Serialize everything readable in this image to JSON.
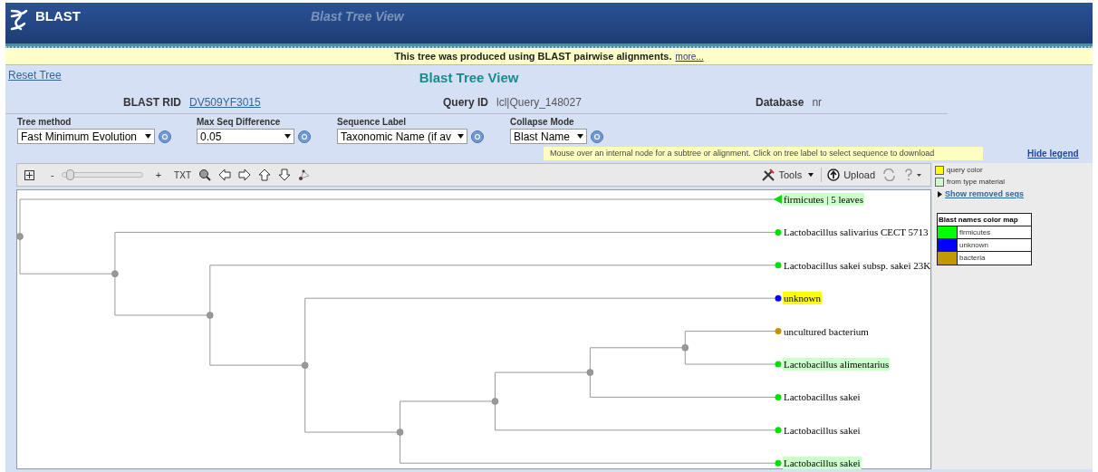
{
  "header": {
    "logo_text": "BLAST",
    "title": "Blast Tree View"
  },
  "notice": {
    "text": "This tree was produced using BLAST pairwise alignments.",
    "link": "more..."
  },
  "reset_link": "Reset Tree",
  "page_title": "Blast Tree View",
  "info": [
    {
      "label": "BLAST RID",
      "value": "DV509YF3015",
      "kind": "link"
    },
    {
      "label": "Query ID",
      "value": "lcl|Query_148027",
      "kind": "plain"
    },
    {
      "label": "Database",
      "value": "nr",
      "kind": "plain"
    }
  ],
  "controls": [
    {
      "label": "Tree method",
      "value": "Fast Minimum Evolution"
    },
    {
      "label": "Max Seq Difference",
      "value": "0.05"
    },
    {
      "label": "Sequence Label",
      "value": "Taxonomic Name (if av"
    },
    {
      "label": "Collapse Mode",
      "value": "Blast Name"
    }
  ],
  "hint": "Mouse over an internal node for a subtree or alignment. Click on tree label to select sequence to download",
  "hide_legend": "Hide legend",
  "toolbar": {
    "zoom_out": "-",
    "zoom_in": "+",
    "txt": "TXT",
    "level": 0.05,
    "tools": "Tools",
    "upload": "Upload"
  },
  "tree": {
    "children": [
      {
        "label": "firmicutes | 5 leaves",
        "kind": "collapsed",
        "color": "#00e000",
        "query": false,
        "type_material": true
      },
      {
        "children": [
          {
            "label": "Lactobacillus salivarius CECT 5713",
            "kind": "leaf",
            "color": "#00e000",
            "query": false,
            "type_material": false
          },
          {
            "children": [
              {
                "label": "Lactobacillus sakei subsp. sakei 23K",
                "kind": "leaf",
                "color": "#00e000",
                "query": false,
                "type_material": false
              },
              {
                "children": [
                  {
                    "label": "unknown",
                    "kind": "leaf",
                    "color": "#0000ff",
                    "query": true,
                    "type_material": false
                  },
                  {
                    "children": [
                      {
                        "children": [
                          {
                            "children": [
                              {
                                "children": [
                                  {
                                    "label": "uncultured bacterium",
                                    "kind": "leaf",
                                    "color": "#c09400",
                                    "query": false,
                                    "type_material": false
                                  },
                                  {
                                    "label": "Lactobacillus alimentarius",
                                    "kind": "leaf",
                                    "color": "#00e000",
                                    "query": false,
                                    "type_material": true
                                  }
                                ]
                              },
                              {
                                "label": "Lactobacillus sakei",
                                "kind": "leaf",
                                "color": "#00e000",
                                "query": false,
                                "type_material": false
                              }
                            ]
                          },
                          {
                            "label": "Lactobacillus sakei",
                            "kind": "leaf",
                            "color": "#00e000",
                            "query": false,
                            "type_material": false
                          }
                        ]
                      },
                      {
                        "label": "Lactobacillus sakei",
                        "kind": "leaf",
                        "color": "#00e000",
                        "query": false,
                        "type_material": true
                      }
                    ]
                  }
                ]
              }
            ]
          }
        ]
      }
    ]
  },
  "legend": {
    "keys": [
      {
        "label": "query color",
        "color": "#ffff00"
      },
      {
        "label": "from type material",
        "color": "#ccffcc"
      }
    ],
    "removed_link": "Show removed seqs",
    "color_map_title": "Blast names color map",
    "color_map": [
      {
        "name": "firmicutes",
        "color": "#00ff00"
      },
      {
        "name": "unknown",
        "color": "#0000ff"
      },
      {
        "name": "bacteria",
        "color": "#c09a00"
      }
    ]
  }
}
